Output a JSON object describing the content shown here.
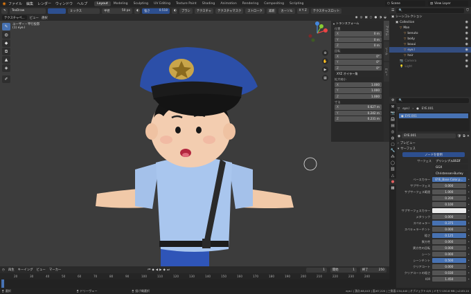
{
  "topbar": {
    "menus": [
      "ファイル",
      "編集",
      "レンダー",
      "ウィンドウ",
      "ヘルプ"
    ],
    "workspaces": [
      "Layout",
      "Modeling",
      "Sculpting",
      "UV Editing",
      "Texture Paint",
      "Shading",
      "Animation",
      "Rendering",
      "Compositing",
      "Scripting"
    ],
    "scene": "Scene",
    "view_layer": "View Layer"
  },
  "toolhdr": {
    "brush": "TexDraw",
    "blend": "ミックス",
    "radius_label": "半径",
    "radius": "50 px",
    "strength_label": "強さ",
    "strength": "0.518",
    "brush_menu": "ブラシ",
    "texture_menu": "テクスチャ",
    "texmask_menu": "テクスチャマスク",
    "stroke_menu": "ストローク",
    "falloff_menu": "減衰",
    "cursor_menu": "カーソル",
    "slot_menu": "テクスチャスロット"
  },
  "vphdr": {
    "mode": "テクスチャペ...",
    "view": "ビュー",
    "select": "選択",
    "overlay_title": "ユーザー・平行投影",
    "overlay_sub": "(1) eye.l"
  },
  "npanel": {
    "transform": "トランスフォーム",
    "location": "位置",
    "loc": [
      "0 m",
      "0 m",
      "0 m"
    ],
    "rotation": "回転",
    "rot": [
      "0°",
      "0°",
      "0°"
    ],
    "euler": "XYZ オイラー角",
    "scale": "拡大縮小",
    "scl": [
      "1.000",
      "1.000",
      "1.000"
    ],
    "dimensions": "寸法",
    "dim": [
      "0.627 m",
      "0.242 m",
      "0.231 m"
    ],
    "axes": [
      "X",
      "Y",
      "Z"
    ],
    "tabs": [
      "アイテム",
      "ツール",
      "ビュー"
    ]
  },
  "timeline": {
    "playback": "再生",
    "keying": "キーイング",
    "view": "ビュー",
    "marker": "マーカー",
    "current": "1",
    "start_label": "開始",
    "start": "1",
    "end_label": "終了",
    "end": "250",
    "ticks": [
      "20",
      "30",
      "40",
      "50",
      "60",
      "70",
      "80",
      "90",
      "100",
      "110",
      "120",
      "130",
      "140",
      "150",
      "160",
      "170",
      "180",
      "190",
      "200",
      "210",
      "220",
      "230",
      "240"
    ]
  },
  "status": {
    "left": "選択",
    "mid1": "ドリーヴュー",
    "mid2": "投げ縄選択",
    "right": "eye.l | 頂点:68,043 | 面:67,220 | 三角面:134,440 | オブジェクト:0/5 | メモリ:150.6 MB | v2.83.10"
  },
  "outliner": {
    "title": "シーンコレクション",
    "items": [
      {
        "name": "Collection",
        "indent": 1
      },
      {
        "name": "Man",
        "indent": 2
      },
      {
        "name": "benuto",
        "indent": 3
      },
      {
        "name": "body",
        "indent": 3
      },
      {
        "name": "bouui",
        "indent": 3
      },
      {
        "name": "eye.l",
        "indent": 3
      },
      {
        "name": "hair",
        "indent": 3
      },
      {
        "name": "Camera",
        "indent": 2
      },
      {
        "name": "Light",
        "indent": 2
      }
    ],
    "selected": "eye.l"
  },
  "props": {
    "object": "eye.l",
    "material": "EYE.001",
    "slot": "EYE.001",
    "mat_field": "EYE.001",
    "preview": "プレビュー",
    "surface": "サーフェス",
    "use_nodes": "ノードを使用",
    "surface_label": "サーフェス",
    "surface_value": "プリンシプルBSDF",
    "ggx": "GGX",
    "sss_method": "Christensen-Burley",
    "rows": [
      {
        "label": "ベースカラー",
        "value": "EYE_Base Color.p...",
        "style": "blue"
      },
      {
        "label": "サブサーフェス",
        "value": "0.000",
        "style": ""
      },
      {
        "label": "サブサーフェス範囲",
        "value": "1.000",
        "style": ""
      },
      {
        "label": "",
        "value": "0.200",
        "style": ""
      },
      {
        "label": "",
        "value": "0.100",
        "style": ""
      },
      {
        "label": "サブサーフェスカラー",
        "value": "",
        "style": "white"
      },
      {
        "label": "メタリック",
        "value": "0.000",
        "style": ""
      },
      {
        "label": "スペキュラー",
        "value": "0.375",
        "style": "blue"
      },
      {
        "label": "スペキュラーチント",
        "value": "0.000",
        "style": ""
      },
      {
        "label": "粗さ",
        "value": "0.125",
        "style": "blue"
      },
      {
        "label": "異方性",
        "value": "0.000",
        "style": ""
      },
      {
        "label": "異方性の回転",
        "value": "0.000",
        "style": ""
      },
      {
        "label": "シーン",
        "value": "0.000",
        "style": ""
      },
      {
        "label": "シーンチント",
        "value": "0.500",
        "style": "blue"
      },
      {
        "label": "クリアコート",
        "value": "0.000",
        "style": ""
      },
      {
        "label": "クリアコートの粗さ",
        "value": "0.030",
        "style": ""
      },
      {
        "label": "IOR",
        "value": "1.450",
        "style": ""
      }
    ]
  },
  "colors": {
    "accent": "#4772b3",
    "viewport_bg": "#3c3c3c",
    "hat": "#2c4fa8",
    "shirt": "#a9c6ee",
    "skin": "#f1c9a8"
  }
}
